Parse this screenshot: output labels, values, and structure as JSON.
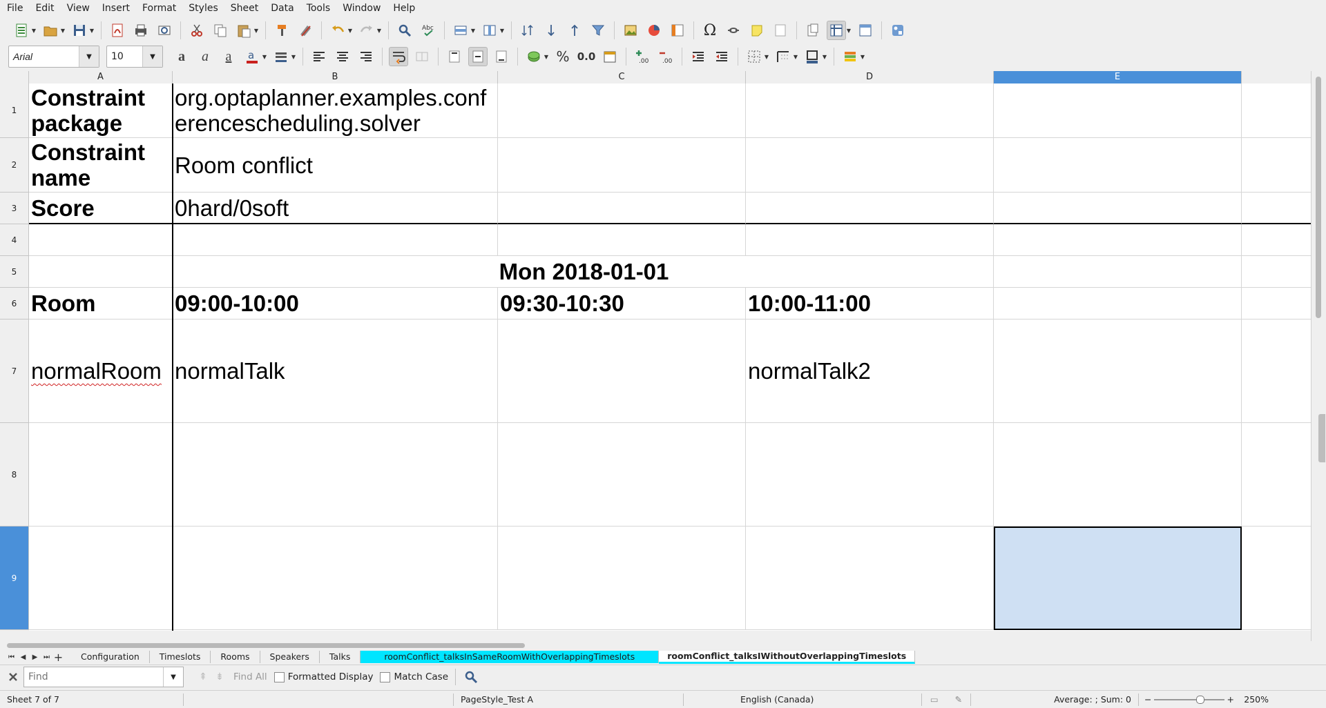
{
  "menu": [
    "File",
    "Edit",
    "View",
    "Insert",
    "Format",
    "Styles",
    "Sheet",
    "Data",
    "Tools",
    "Window",
    "Help"
  ],
  "toolbar": {
    "font_name": "Arial",
    "font_size": "10",
    "number_format_decimal": "0.0",
    "percent_symbol": "%"
  },
  "columns": [
    "A",
    "B",
    "C",
    "D",
    "E"
  ],
  "rows": [
    "1",
    "2",
    "3",
    "4",
    "5",
    "6",
    "7",
    "8",
    "9"
  ],
  "cells": {
    "A1": "Constraint package",
    "B1": "org.optaplanner.examples.conferencescheduling.solver",
    "A2": "Constraint name",
    "B2": "Room conflict",
    "A3": "Score",
    "B3": "0hard/0soft",
    "B5": "Mon 2018-01-01",
    "A6": "Room",
    "B6": "09:00-10:00",
    "C6": "09:30-10:30",
    "D6": "10:00-11:00",
    "A7": "normalRoom",
    "B7": "normalTalk",
    "D7": "normalTalk2"
  },
  "sheet_tabs": [
    {
      "label": "Configuration"
    },
    {
      "label": "Timeslots"
    },
    {
      "label": "Rooms"
    },
    {
      "label": "Speakers"
    },
    {
      "label": "Talks"
    },
    {
      "label": "roomConflict_talksInSameRoomWithOverlappingTimeslots",
      "color": "#00e5ff"
    },
    {
      "label": "roomConflict_talksIWithoutOverlappingTimeslots",
      "current": true
    }
  ],
  "find": {
    "placeholder": "Find",
    "find_all": "Find All",
    "formatted_display": "Formatted Display",
    "match_case": "Match Case"
  },
  "status": {
    "sheet": "Sheet 7 of 7",
    "page_style": "PageStyle_Test A",
    "language": "English (Canada)",
    "summary": "Average: ; Sum: 0",
    "zoom": "250%"
  },
  "colors": {
    "selection": "#4a90d9",
    "selected_cell_fill": "#cfe0f3",
    "tab_highlight": "#00e5ff"
  }
}
